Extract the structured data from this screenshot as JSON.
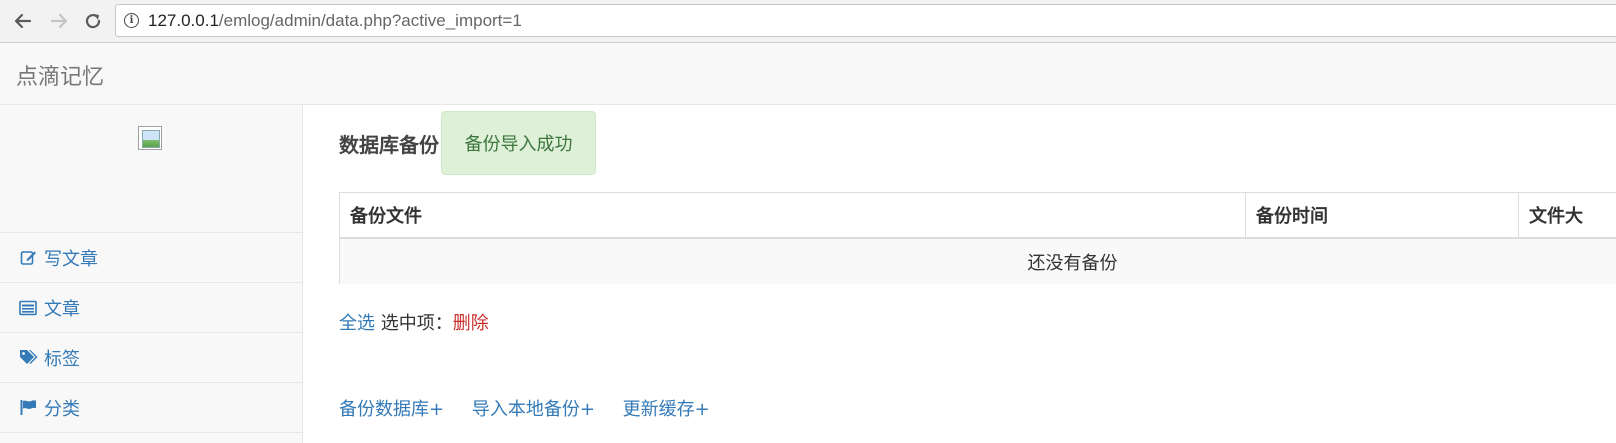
{
  "browser": {
    "url_host": "127.0.0.1",
    "url_path": "/emlog/admin/data.php?active_import=1"
  },
  "header": {
    "brand": "点滴记忆"
  },
  "sidebar": {
    "items": [
      {
        "label": "写文章",
        "icon": "edit-icon"
      },
      {
        "label": "文章",
        "icon": "list-icon"
      },
      {
        "label": "标签",
        "icon": "tags-icon"
      },
      {
        "label": "分类",
        "icon": "flag-icon"
      }
    ]
  },
  "main": {
    "title": "数据库备份",
    "alert": "备份导入成功",
    "table": {
      "columns": [
        "备份文件",
        "备份时间",
        "文件大"
      ],
      "empty_text": "还没有备份"
    },
    "bulk": {
      "select_all": "全选",
      "selected_label": "选中项：",
      "delete": "删除"
    },
    "actions": [
      "备份数据库+",
      "导入本地备份+",
      "更新缓存+"
    ]
  },
  "colors": {
    "link": "#337ab7",
    "alert_bg": "#dff0d8",
    "alert_text": "#3c763d",
    "danger": "#c9302c"
  }
}
